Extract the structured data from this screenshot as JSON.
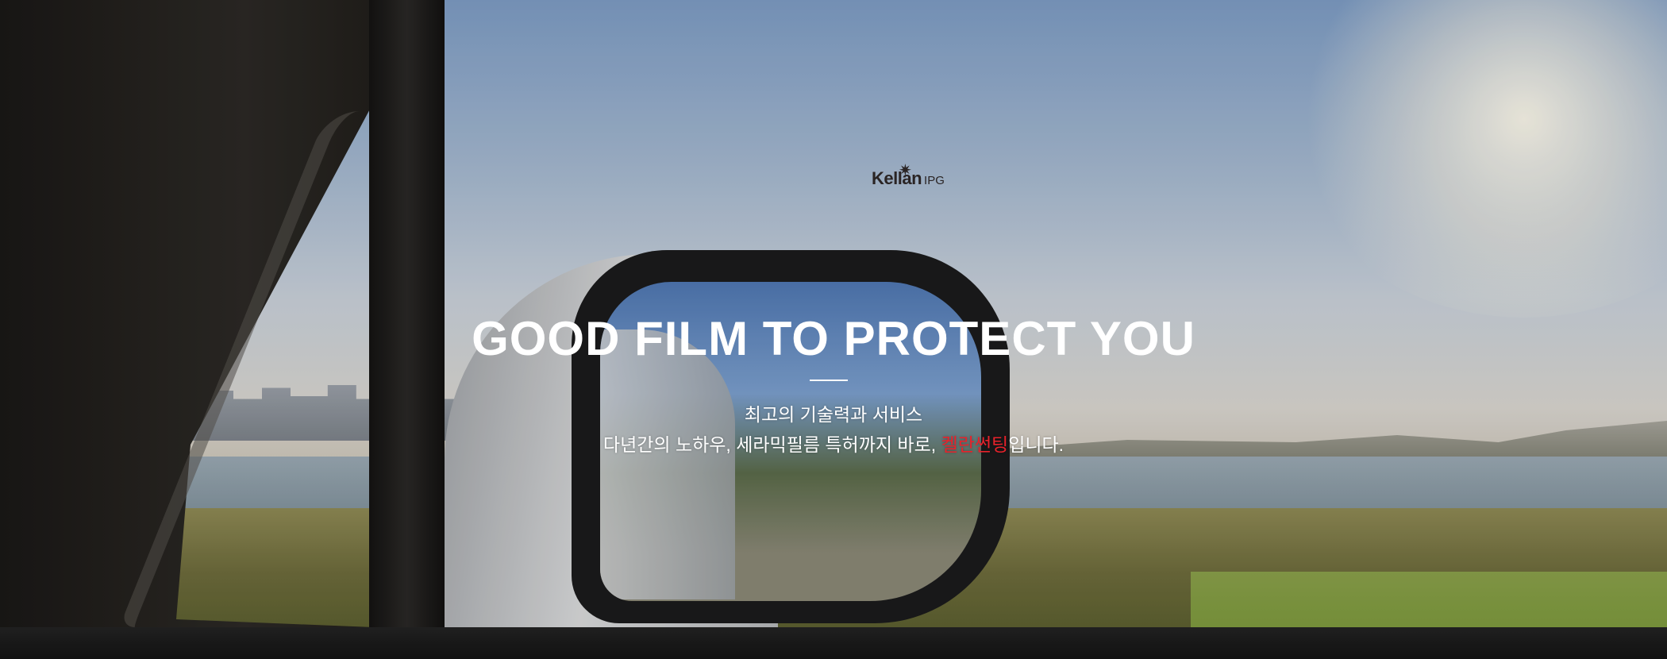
{
  "logo": {
    "name": "Kellan",
    "suffix": "IPG"
  },
  "hero": {
    "title": "GOOD FILM TO PROTECT YOU",
    "subtitle_line1": "최고의 기술력과 서비스",
    "subtitle_line2_before": "다년간의 노하우, 세라믹필름 특허까지 바로, ",
    "subtitle_line2_highlight": "켈란썬팅",
    "subtitle_line2_after": "입니다.",
    "highlight_color": "#e8222b"
  }
}
